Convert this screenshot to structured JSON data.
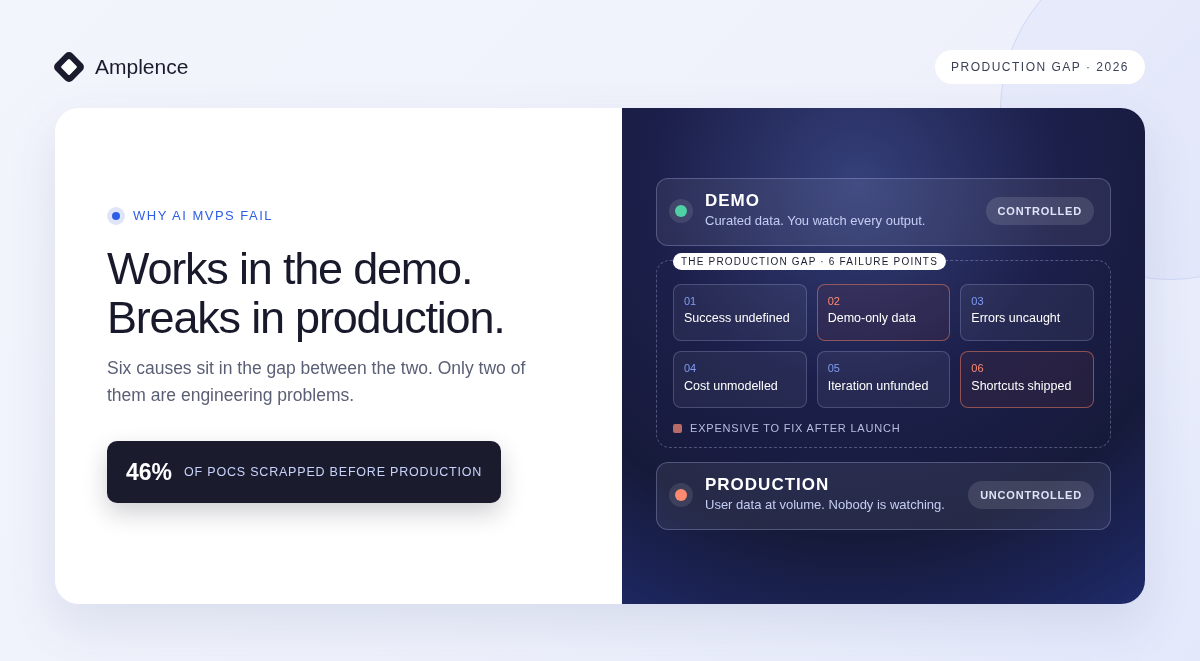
{
  "brand": {
    "name": "Amplence"
  },
  "tag": "PRODUCTION GAP · 2026",
  "eyebrow": "WHY AI MVPS FAIL",
  "headline": [
    "Works in the demo.",
    "Breaks in production."
  ],
  "subtext": "Six causes sit in the gap between the two. Only two of them are engineering problems.",
  "stat": {
    "value": "46%",
    "label": "OF POCS SCRAPPED BEFORE PRODUCTION"
  },
  "stages": [
    {
      "title": "DEMO",
      "description": "Curated data. You watch every output.",
      "badge": "CONTROLLED",
      "color": "#4fd1a5"
    },
    {
      "title": "PRODUCTION",
      "description": "User data at volume. Nobody is watching.",
      "badge": "UNCONTROLLED",
      "color": "#ff8a70"
    }
  ],
  "gap": {
    "label": "THE PRODUCTION GAP · 6 FAILURE POINTS",
    "cells": [
      {
        "number": "01",
        "text": "Success undefined",
        "expensive": false
      },
      {
        "number": "02",
        "text": "Demo-only data",
        "expensive": true
      },
      {
        "number": "03",
        "text": "Errors uncaught",
        "expensive": false
      },
      {
        "number": "04",
        "text": "Cost unmodelled",
        "expensive": false
      },
      {
        "number": "05",
        "text": "Iteration unfunded",
        "expensive": false
      },
      {
        "number": "06",
        "text": "Shortcuts shipped",
        "expensive": true
      }
    ],
    "legend": "EXPENSIVE TO FIX AFTER LAUNCH"
  }
}
